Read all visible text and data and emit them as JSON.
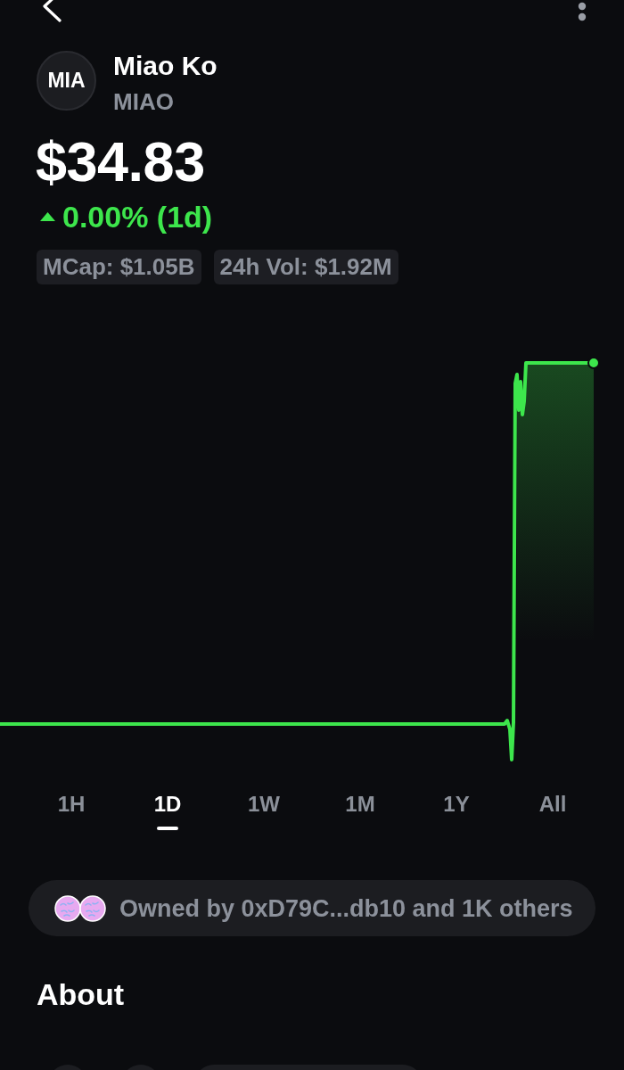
{
  "token": {
    "avatar_text": "MIA",
    "name": "Miao Ko",
    "symbol": "MIAO"
  },
  "price": {
    "value": "$34.83",
    "rising": true,
    "change": "0.00% (1d)"
  },
  "stats": [
    {
      "text": "MCap: $1.05B"
    },
    {
      "text": "24h Vol: $1.92M"
    }
  ],
  "timeframes": [
    {
      "label": "1H",
      "selected": false
    },
    {
      "label": "1D",
      "selected": true
    },
    {
      "label": "1W",
      "selected": false
    },
    {
      "label": "1M",
      "selected": false
    },
    {
      "label": "1Y",
      "selected": false
    },
    {
      "label": "All",
      "selected": false
    }
  ],
  "owners": {
    "text": "Owned by 0xD79C...db10 and 1K others"
  },
  "about": {
    "title": "About"
  }
}
